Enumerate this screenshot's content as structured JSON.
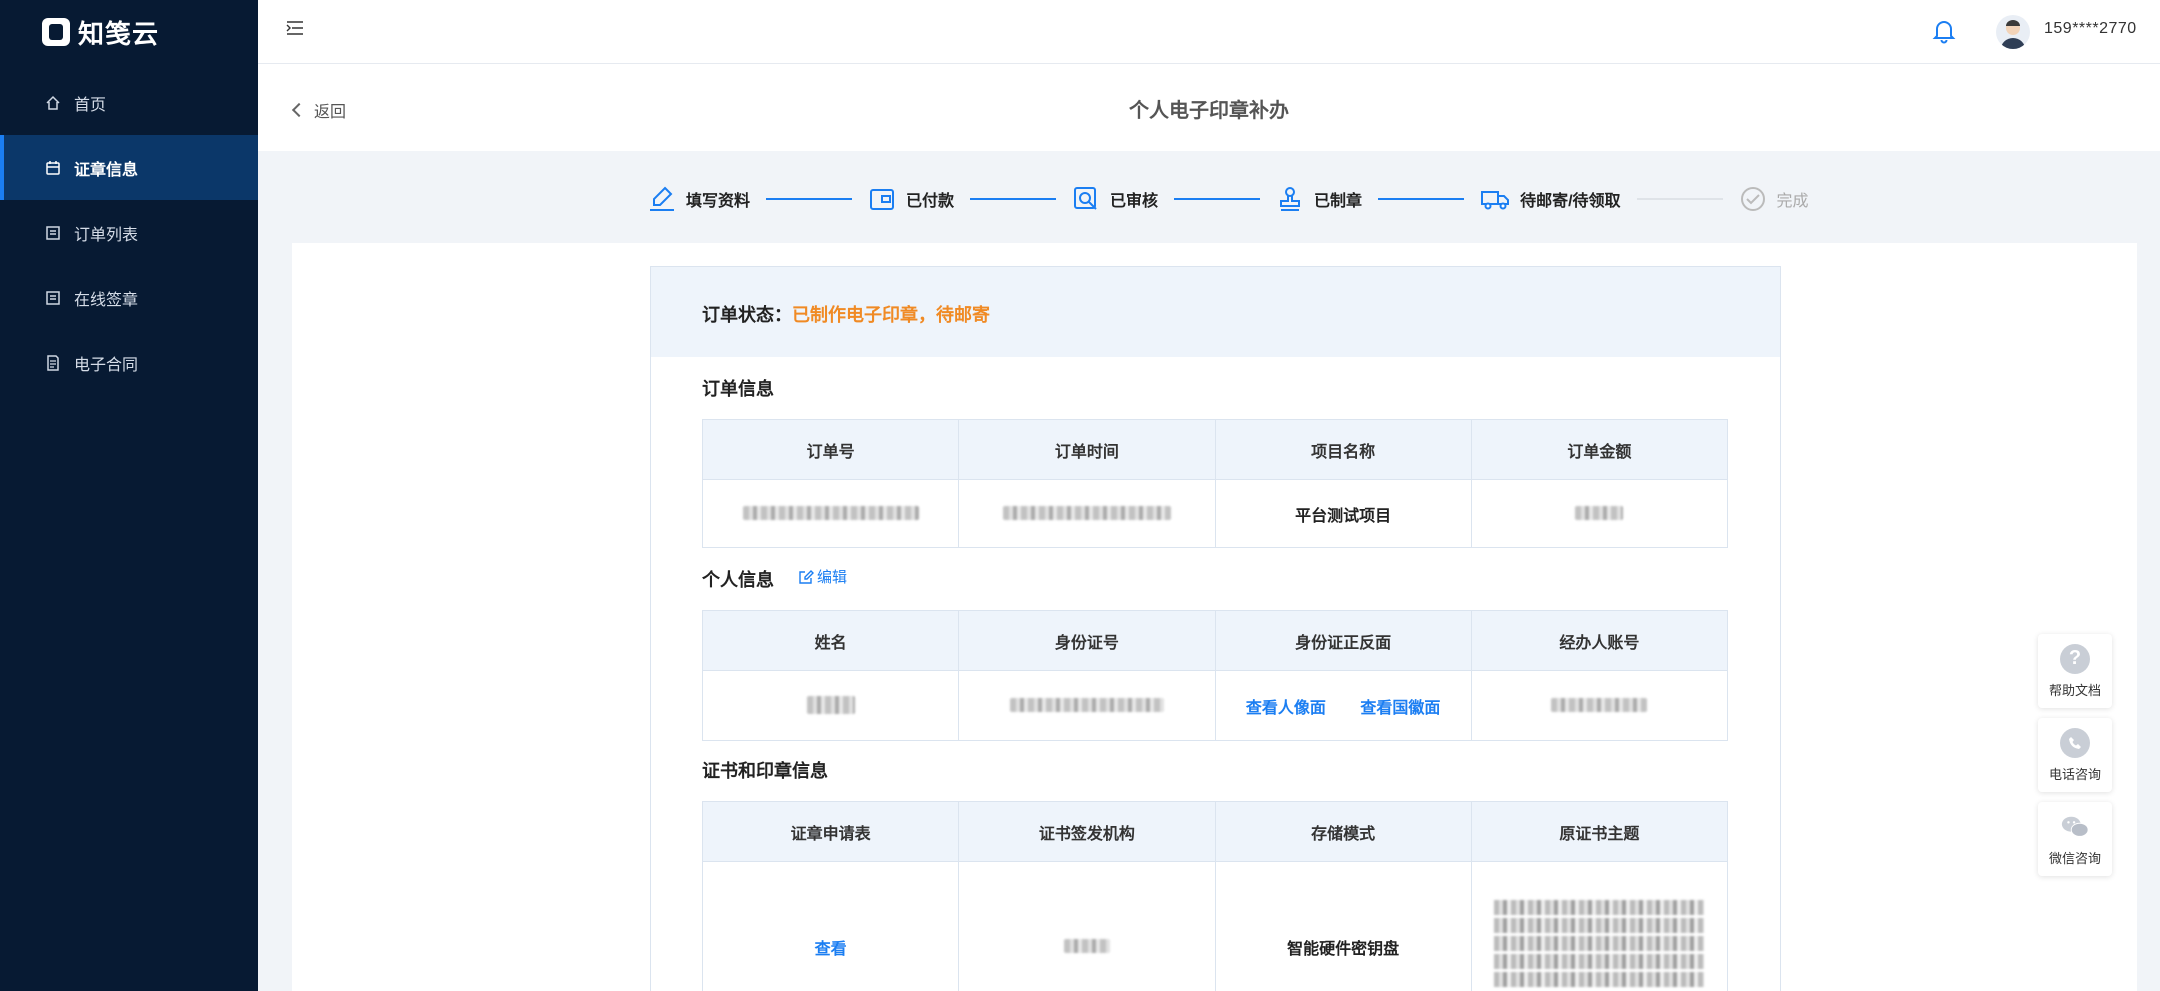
{
  "app": {
    "logo_text": "知笺云"
  },
  "sidebar": {
    "items": [
      {
        "label": "首页",
        "icon": "home-icon",
        "active": false
      },
      {
        "label": "证章信息",
        "icon": "calendar-icon",
        "active": true
      },
      {
        "label": "订单列表",
        "icon": "list-icon",
        "active": false
      },
      {
        "label": "在线签章",
        "icon": "sign-icon",
        "active": false
      },
      {
        "label": "电子合同",
        "icon": "contract-icon",
        "active": false
      }
    ]
  },
  "header": {
    "user": "159****2770"
  },
  "page": {
    "back_label": "返回",
    "title": "个人电子印章补办"
  },
  "steps": [
    {
      "label": "填写资料",
      "icon": "pen-icon",
      "done": true
    },
    {
      "label": "已付款",
      "icon": "wallet-icon",
      "done": true
    },
    {
      "label": "已审核",
      "icon": "review-icon",
      "done": true
    },
    {
      "label": "已制章",
      "icon": "stamp-icon",
      "done": true
    },
    {
      "label": "待邮寄/待领取",
      "icon": "truck-icon",
      "done": true
    },
    {
      "label": "完成",
      "icon": "check-circle-icon",
      "done": false
    }
  ],
  "order_status": {
    "label": "订单状态：",
    "value": "已制作电子印章，待邮寄"
  },
  "order_info": {
    "title": "订单信息",
    "headers": [
      "订单号",
      "订单时间",
      "项目名称",
      "订单金额"
    ],
    "row": {
      "project": "平台测试项目"
    }
  },
  "personal_info": {
    "title": "个人信息",
    "edit_label": "编辑",
    "headers": [
      "姓名",
      "身份证号",
      "身份证正反面",
      "经办人账号"
    ],
    "row": {
      "id_front_link": "查看人像面",
      "id_back_link": "查看国徽面"
    }
  },
  "cert_info": {
    "title": "证书和印章信息",
    "headers": [
      "证章申请表",
      "证书签发机构",
      "存储模式",
      "原证书主题"
    ],
    "row": {
      "form_link": "查看",
      "storage": "智能硬件密钥盘"
    }
  },
  "float_tools": [
    {
      "label": "帮助文档",
      "icon": "question-icon"
    },
    {
      "label": "电话咨询",
      "icon": "phone-icon"
    },
    {
      "label": "微信咨询",
      "icon": "wechat-icon"
    }
  ],
  "colors": {
    "sidebar_bg": "#071a33",
    "active_bg": "#0b3769",
    "accent": "#1b7ef2",
    "status": "#f08a24"
  }
}
